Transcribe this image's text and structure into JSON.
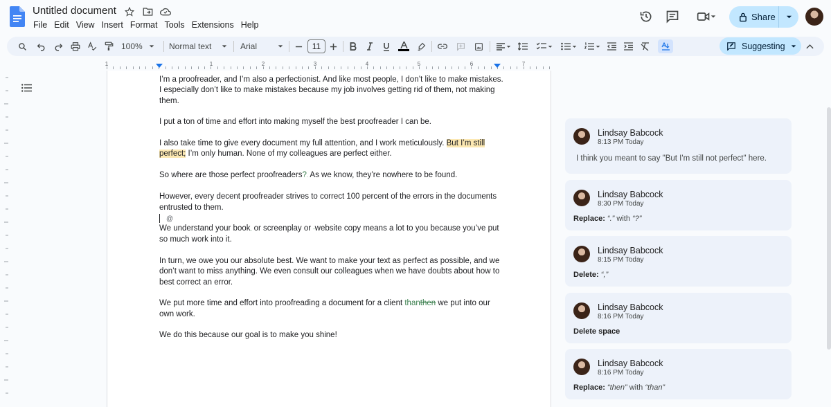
{
  "header": {
    "title": "Untitled document",
    "menu": [
      "File",
      "Edit",
      "View",
      "Insert",
      "Format",
      "Tools",
      "Extensions",
      "Help"
    ],
    "share_label": "Share"
  },
  "toolbar": {
    "zoom": "100%",
    "style": "Normal text",
    "font": "Arial",
    "font_size": "11",
    "mode": "Suggesting"
  },
  "ruler": {
    "numbers": [
      "1",
      "1",
      "2",
      "3",
      "4",
      "5",
      "6",
      "7"
    ]
  },
  "document": {
    "p1": "I’m a proofreader, and I’m also a perfectionist. And like most people, I don’t like to make mistakes. I especially don’t like to make mistakes because my job involves getting rid of them, not making them.",
    "p2": "I put a ton of time and effort into making myself the best proofreader I can be.",
    "p3_a": "I also take time to give every document my full attention, and I work meticulously. ",
    "p3_hl": "But I’m still perfect;",
    "p3_b": " I’m only human. None of my colleagues are perfect either.",
    "p4_a": "So where are those perfect proofreaders",
    "p4_ins": "?",
    "p4_del": ".",
    "p4_b": " As we know, they’re nowhere to be found.",
    "p5": "However, every decent proofreader strives to correct 100 percent of the errors in the documents entrusted to them.",
    "at_symbol": "@",
    "p6_a": "We understand your book",
    "p6_mark": ",",
    "p6_b": " or screenplay or ",
    "p6_mark2": "-",
    "p6_c": "website copy means a lot to you because you’ve put so much work into it.",
    "p7": "In turn, we owe you our absolute best. We want to make your text as perfect as possible, and we don’t want to miss anything. We even consult our colleagues when we have doubts about how to best correct an error.",
    "p8_a": "We put more time and effort into proofreading a document for a client ",
    "p8_ins": "than",
    "p8_del": "then",
    "p8_b": " we put into our own work.",
    "p9": "We do this because our goal is to make you shine!"
  },
  "comments": [
    {
      "author": "Lindsay Babcock",
      "time": "8:13 PM Today",
      "text": "I think you meant to say \"But I'm still not perfect\" here."
    },
    {
      "author": "Lindsay Babcock",
      "time": "8:30 PM Today",
      "action": "Replace:",
      "detail_a": "“.”",
      "detail_mid": " with ",
      "detail_b": "“?”"
    },
    {
      "author": "Lindsay Babcock",
      "time": "8:15 PM Today",
      "action": "Delete:",
      "detail_a": "“,”"
    },
    {
      "author": "Lindsay Babcock",
      "time": "8:16 PM Today",
      "action": "Delete space"
    },
    {
      "author": "Lindsay Babcock",
      "time": "8:16 PM Today",
      "action": "Replace:",
      "detail_a": "“then”",
      "detail_mid": " with ",
      "detail_b": "“than”"
    }
  ],
  "colors": {
    "accent": "#1a73e8",
    "share_bg": "#c2e7ff",
    "toolbar_bg": "#edf2fa",
    "highlight": "#fce8b2",
    "suggestion_green": "#3b7f4e"
  }
}
